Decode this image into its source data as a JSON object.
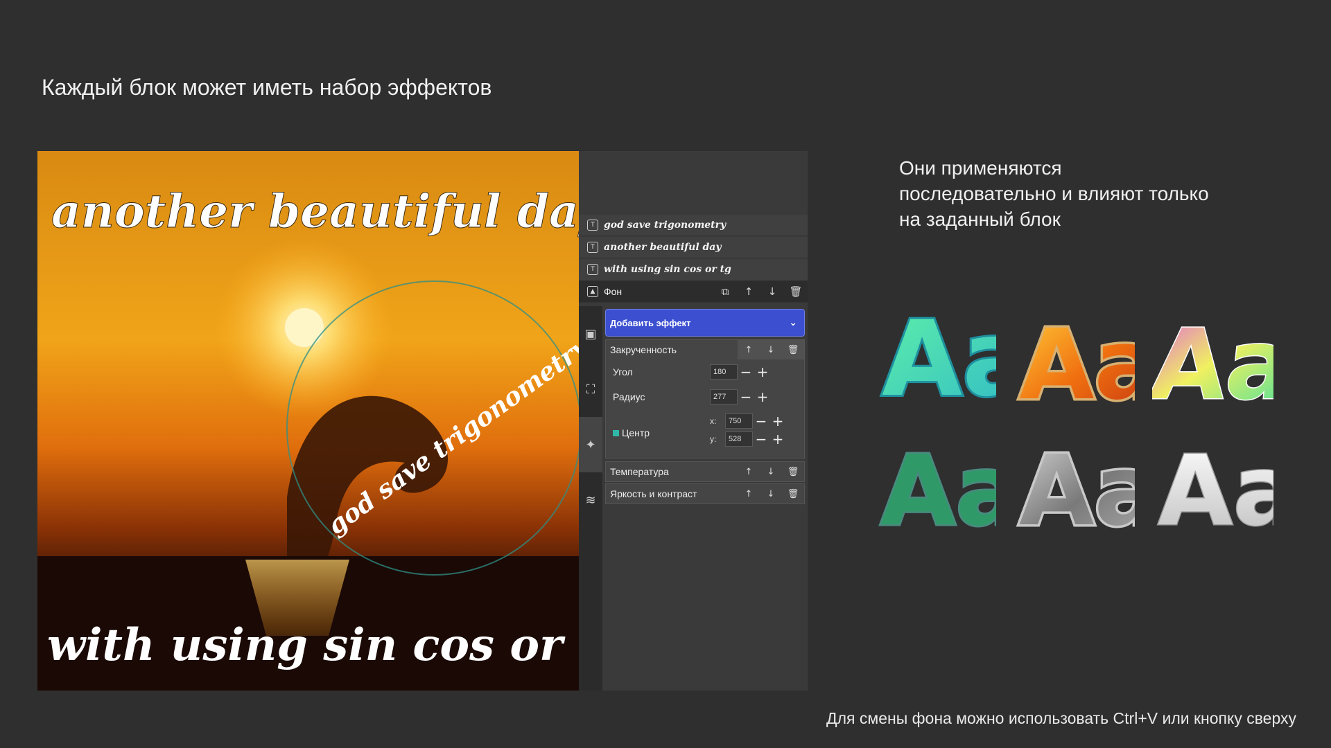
{
  "slide": {
    "title": "Каждый блок может иметь набор эффектов",
    "side_note": [
      "Они применяются",
      "последовательно и влияют только",
      "на заданный блок"
    ],
    "footer": "Для смены фона можно использовать Ctrl+V или кнопку сверху"
  },
  "canvas": {
    "texts": [
      "another beautiful day",
      "god save trigonometry",
      "with using sin cos or tg"
    ]
  },
  "layers": [
    {
      "label": "god save trigonometry",
      "icon": "text-layer-icon"
    },
    {
      "label": "another beautiful day",
      "icon": "text-layer-icon"
    },
    {
      "label": "with using sin cos or tg",
      "icon": "text-layer-icon"
    },
    {
      "label": "Фон",
      "icon": "image-layer-icon",
      "active": true
    }
  ],
  "layer_actions": [
    "copy-icon",
    "arrow-up-icon",
    "arrow-down-icon",
    "trash-icon"
  ],
  "side_tabs": [
    "image-icon",
    "fullscreen-icon",
    "magic-wand-icon",
    "layers-icon"
  ],
  "effects_panel": {
    "add_effect_label": "Добавить эффект",
    "effects": [
      {
        "name": "Закрученность",
        "expanded": true,
        "params": {
          "angle_label": "Угол",
          "angle_value": "180",
          "radius_label": "Радиус",
          "radius_value": "277",
          "center_label": "Центр",
          "center_x_label": "x:",
          "center_x": "750",
          "center_y_label": "y:",
          "center_y": "528"
        }
      },
      {
        "name": "Температура",
        "expanded": false
      },
      {
        "name": "Яркость и контраст",
        "expanded": false
      }
    ]
  },
  "samples": {
    "glyph_text": "Aa",
    "tiles": [
      "teal-outline",
      "fire-glitter",
      "rainbow-swirl",
      "green-noise",
      "silver-glitter",
      "chrome-white"
    ]
  },
  "colors": {
    "background": "#2f2f2f",
    "accent_button": "#3b4fd0",
    "center_swatch": "#2fb8a8"
  }
}
